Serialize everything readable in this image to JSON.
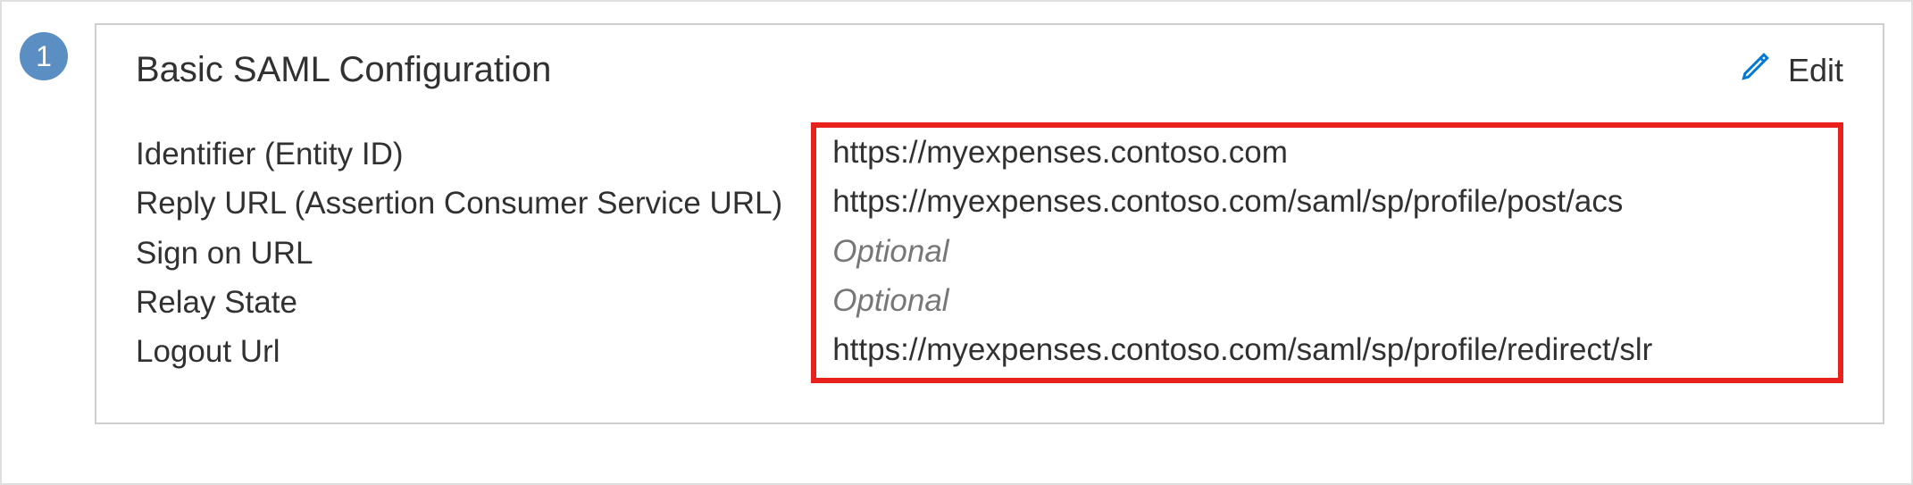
{
  "step": "1",
  "card": {
    "title": "Basic SAML Configuration",
    "edit_label": "Edit"
  },
  "fields": {
    "identifier": {
      "label": "Identifier (Entity ID)",
      "value": "https://myexpenses.contoso.com",
      "optional": false
    },
    "reply_url": {
      "label": "Reply URL (Assertion Consumer Service URL)",
      "value": "https://myexpenses.contoso.com/saml/sp/profile/post/acs",
      "optional": false
    },
    "sign_on_url": {
      "label": "Sign on URL",
      "value": "Optional",
      "optional": true
    },
    "relay_state": {
      "label": "Relay State",
      "value": "Optional",
      "optional": true
    },
    "logout_url": {
      "label": "Logout Url",
      "value": "https://myexpenses.contoso.com/saml/sp/profile/redirect/slr",
      "optional": false
    }
  }
}
